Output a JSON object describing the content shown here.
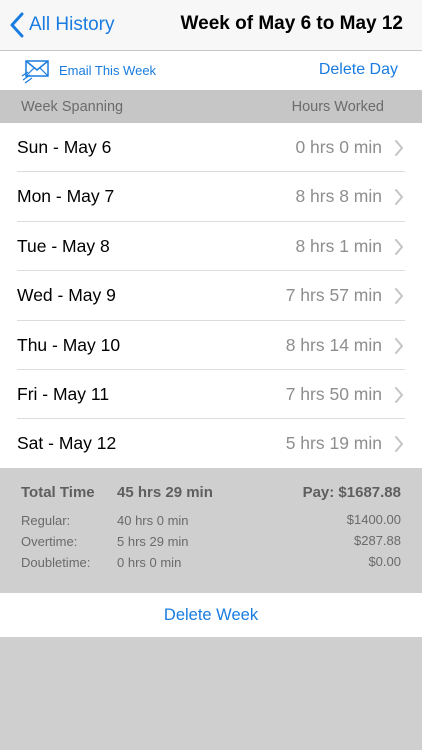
{
  "navbar": {
    "back_label": "All History",
    "title": "Week of May 6 to May 12"
  },
  "toolbar": {
    "email_label": "Email This Week",
    "delete_day_label": "Delete Day"
  },
  "section_header": {
    "left": "Week Spanning",
    "right": "Hours Worked"
  },
  "days": [
    {
      "day": "Sun - May 6",
      "hours": "0 hrs 0 min"
    },
    {
      "day": "Mon - May 7",
      "hours": "8 hrs 8 min"
    },
    {
      "day": "Tue - May 8",
      "hours": "8 hrs 1 min"
    },
    {
      "day": "Wed - May 9",
      "hours": "7 hrs 57 min"
    },
    {
      "day": "Thu - May 10",
      "hours": "8 hrs 14 min"
    },
    {
      "day": "Fri - May 11",
      "hours": "7 hrs 50 min"
    },
    {
      "day": "Sat - May 12",
      "hours": "5 hrs 19 min"
    }
  ],
  "summary": {
    "total_label": "Total Time",
    "total_value": "45 hrs 29 min",
    "pay": "Pay: $1687.88",
    "regular_label": "Regular:",
    "regular_value": "40 hrs 0 min",
    "regular_pay": "$1400.00",
    "overtime_label": "Overtime:",
    "overtime_value": "5 hrs 29 min",
    "overtime_pay": "$287.88",
    "doubletime_label": "Doubletime:",
    "doubletime_value": "0 hrs 0 min",
    "doubletime_pay": "$0.00"
  },
  "footer": {
    "delete_week_label": "Delete Week"
  },
  "colors": {
    "accent": "#1a7ce0",
    "secondary_text": "#8e8e8e",
    "background": "#cfcfcf"
  },
  "icons": {
    "back": "chevron-left-icon",
    "email": "email-envelope-icon",
    "row_disclosure": "chevron-right-icon"
  }
}
